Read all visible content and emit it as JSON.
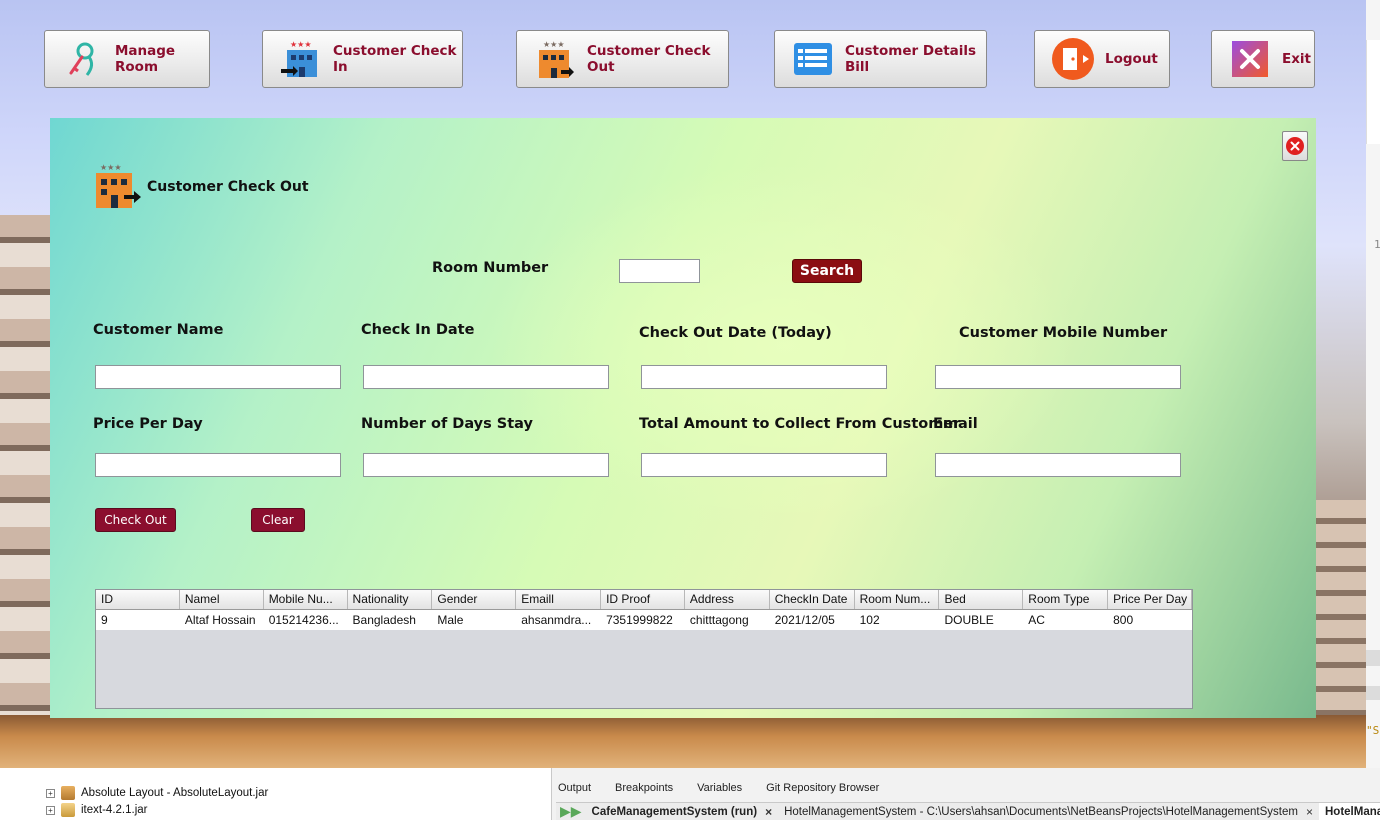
{
  "nav": {
    "manage_room": "Manage Room",
    "check_in": "Customer Check In",
    "check_out": "Customer Check Out",
    "details_bill": "Customer Details Bill",
    "logout": "Logout",
    "exit": "Exit"
  },
  "dialog": {
    "title": "Customer Check Out",
    "room_number_label": "Room Number",
    "room_number_value": "",
    "search_label": "Search",
    "fields": {
      "customer_name_label": "Customer Name",
      "check_in_date_label": "Check In Date",
      "check_out_date_label": "Check Out Date (Today)",
      "mobile_label": "Customer Mobile Number",
      "price_label": "Price Per Day",
      "days_label": "Number of Days Stay",
      "total_label": "Total Amount to Collect From Customer",
      "email_label": "Email"
    },
    "checkout_btn": "Check Out",
    "clear_btn": "Clear"
  },
  "table": {
    "columns": [
      "ID",
      "Namel",
      "Mobile Nu...",
      "Nationality",
      "Gender",
      "Emaill",
      "ID Proof",
      "Address",
      "CheckIn Date",
      "Room Num...",
      "Bed",
      "Room Type",
      "Price Per Day"
    ],
    "rows": [
      [
        "9",
        "Altaf Hossain",
        "015214236...",
        "Bangladesh",
        "Male",
        "ahsanmdra...",
        "7351999822",
        "chitttagong",
        "2021/12/05",
        "102",
        "DOUBLE",
        "AC",
        "800"
      ]
    ]
  },
  "ide": {
    "project_items": [
      "Absolute Layout - AbsoluteLayout.jar",
      "itext-4.2.1.jar"
    ],
    "output_tabs": [
      "Output",
      "Breakpoints",
      "Variables",
      "Git Repository Browser"
    ],
    "run_tabs": [
      "CafeManagementSystem (run)",
      "HotelManagementSystem - C:\\Users\\ahsan\\Documents\\NetBeansProjects\\HotelManagementSystem",
      "HotelManage"
    ],
    "right_char_1": "1",
    "right_char_2": "\"S"
  },
  "colors": {
    "accent_red": "#8b0e2e",
    "search_red": "#8b0e12",
    "nav_text": "#8b0e2e"
  }
}
